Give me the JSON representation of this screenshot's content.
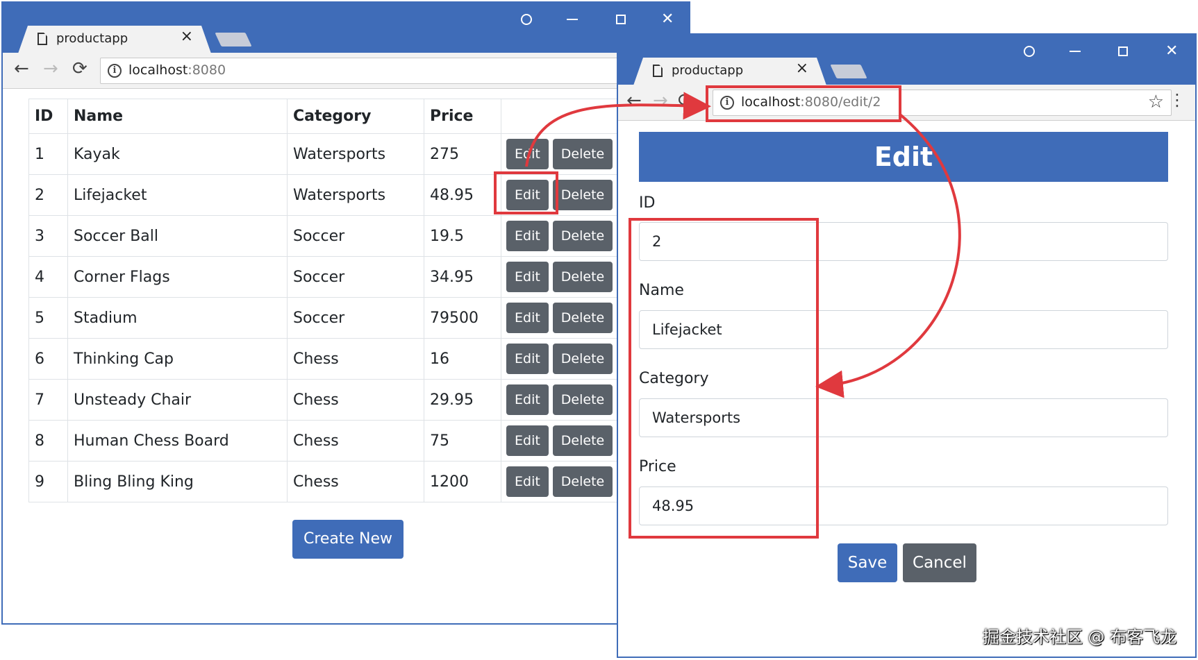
{
  "window_list": {
    "tab_title": "productapp",
    "url_host": "localhost",
    "url_rest": ":8080",
    "table": {
      "headers": [
        "ID",
        "Name",
        "Category",
        "Price",
        ""
      ],
      "rows": [
        [
          "1",
          "Kayak",
          "Watersports",
          "275"
        ],
        [
          "2",
          "Lifejacket",
          "Watersports",
          "48.95"
        ],
        [
          "3",
          "Soccer Ball",
          "Soccer",
          "19.5"
        ],
        [
          "4",
          "Corner Flags",
          "Soccer",
          "34.95"
        ],
        [
          "5",
          "Stadium",
          "Soccer",
          "79500"
        ],
        [
          "6",
          "Thinking Cap",
          "Chess",
          "16"
        ],
        [
          "7",
          "Unsteady Chair",
          "Chess",
          "29.95"
        ],
        [
          "8",
          "Human Chess Board",
          "Chess",
          "75"
        ],
        [
          "9",
          "Bling Bling King",
          "Chess",
          "1200"
        ]
      ],
      "edit_label": "Edit",
      "delete_label": "Delete"
    },
    "create_label": "Create New"
  },
  "window_edit": {
    "tab_title": "productapp",
    "url_host": "localhost",
    "url_rest": ":8080/edit/2",
    "header": "Edit",
    "fields": [
      {
        "label": "ID",
        "value": "2"
      },
      {
        "label": "Name",
        "value": "Lifejacket"
      },
      {
        "label": "Category",
        "value": "Watersports"
      },
      {
        "label": "Price",
        "value": "48.95"
      }
    ],
    "save_label": "Save",
    "cancel_label": "Cancel"
  },
  "icons": {
    "close_tab": "×",
    "back": "←",
    "forward": "→",
    "reload": "⟳",
    "window_close": "✕",
    "star": "☆",
    "menu": "⋮",
    "info": "i"
  },
  "colors": {
    "chrome_blue": "#3f6cb8",
    "primary": "#3f6cb8",
    "secondary": "#5a6169",
    "annotation_red": "#e0393e"
  },
  "watermark": "掘金技术社区 @ 布客飞龙"
}
